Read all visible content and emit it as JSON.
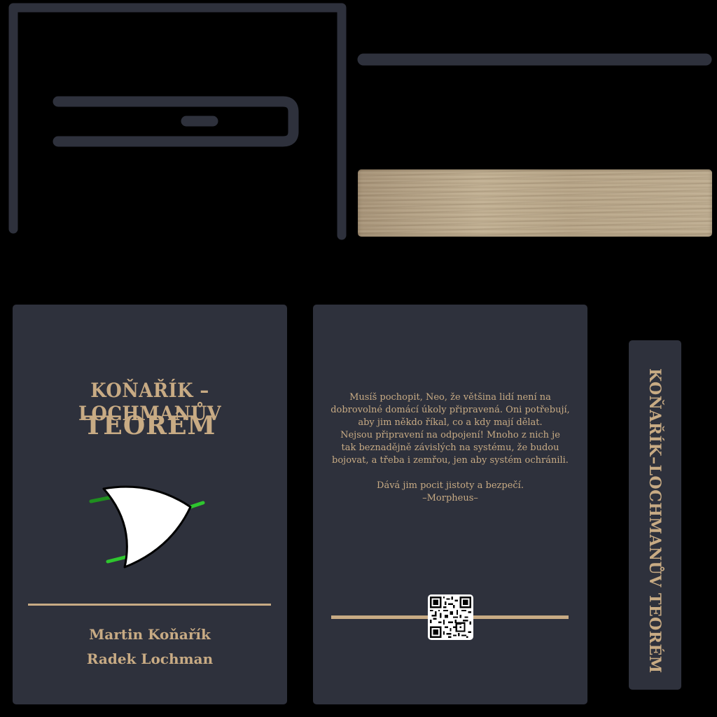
{
  "colors": {
    "panel": "#2e313c",
    "gold": "#c8ab84",
    "frame_line": "#2e313c",
    "wood": "#b3a185",
    "logo_fill": "#ffffff",
    "logo_lead_green": "#2ec62e"
  },
  "front_cover": {
    "title_line_1": "KOŇAŘÍK – LOCHMANŮV",
    "title_line_2": "TEORÉM",
    "logo_icon": "or-gate-icon",
    "authors": [
      "Martin Koňařík",
      "Radek Lochman"
    ]
  },
  "back_cover": {
    "quote_lines": [
      "Musíš pochopit, Neo, že většina lidí není na",
      "dobrovolné domácí úkoly připravená. Oni potřebují,",
      "aby jim někdo říkal, co a kdy mají dělat.",
      "Nejsou připravení na odpojení! Mnoho z nich je",
      "tak beznadějně závislých na systému, že budou",
      "bojovat, a třeba i zemřou, jen aby systém ochránili."
    ],
    "quote_closing": "Dává jim pocit jistoty a bezpečí.",
    "quote_attribution": "–Morpheus–",
    "qr_icon": "qr-code-icon"
  },
  "spine": {
    "title": "KOŇAŘÍK–LOCHMANŮV TEORÉM"
  }
}
